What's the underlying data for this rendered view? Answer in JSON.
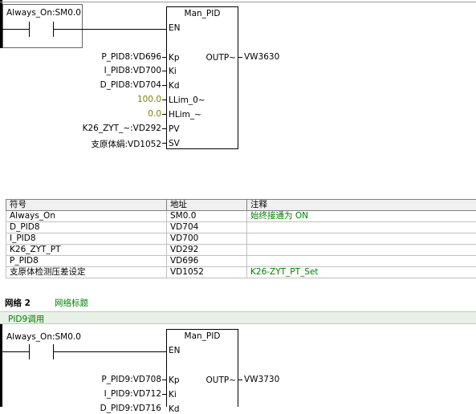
{
  "network1": {
    "contact_label": "Always_On:SM0.0",
    "block": {
      "title": "Man_PID",
      "en": "EN",
      "inputs": [
        {
          "wire": "P_PID8:VD696",
          "pin": "Kp"
        },
        {
          "wire": "I_PID8:VD700",
          "pin": "Ki"
        },
        {
          "wire": "D_PID8:VD704",
          "pin": "Kd"
        },
        {
          "wire": "100.0",
          "pin": "LLim_0~"
        },
        {
          "wire": "0.0",
          "pin": "HLim_~"
        },
        {
          "wire": "K26_ZYT_~:VD292",
          "pin": "PV"
        },
        {
          "wire": "支原体絹:VD1052",
          "pin": "SV"
        }
      ],
      "output_pin": "OUTP~",
      "output_wire": "VW3630"
    }
  },
  "symbol_table": {
    "headers": [
      "符号",
      "地址",
      "注释"
    ],
    "rows": [
      {
        "symbol": "Always_On",
        "address": "SM0.0",
        "comment": "始终接通为 ON"
      },
      {
        "symbol": "D_PID8",
        "address": "VD704",
        "comment": ""
      },
      {
        "symbol": "I_PID8",
        "address": "VD700",
        "comment": ""
      },
      {
        "symbol": "K26_ZYT_PT",
        "address": "VD292",
        "comment": ""
      },
      {
        "symbol": "P_PID8",
        "address": "VD696",
        "comment": ""
      },
      {
        "symbol": "支原体检测压差设定",
        "address": "VD1052",
        "comment": "K26-ZYT_PT_Set"
      }
    ]
  },
  "network2": {
    "label": "网络 2",
    "title": "网络标题",
    "comment": "PID9调用",
    "contact_label": "Always_On:SM0.0",
    "block": {
      "title": "Man_PID",
      "en": "EN",
      "inputs": [
        {
          "wire": "P_PID9:VD708",
          "pin": "Kp"
        },
        {
          "wire": "I_PID9:VD712",
          "pin": "Ki"
        },
        {
          "wire": "D_PID9:VD716",
          "pin": "Kd"
        }
      ],
      "output_pin": "OUTP~",
      "output_wire": "VW3730"
    }
  },
  "colors": {
    "constant": "#808000",
    "comment": "#008000",
    "comment_bar": "#e8f0e8"
  }
}
